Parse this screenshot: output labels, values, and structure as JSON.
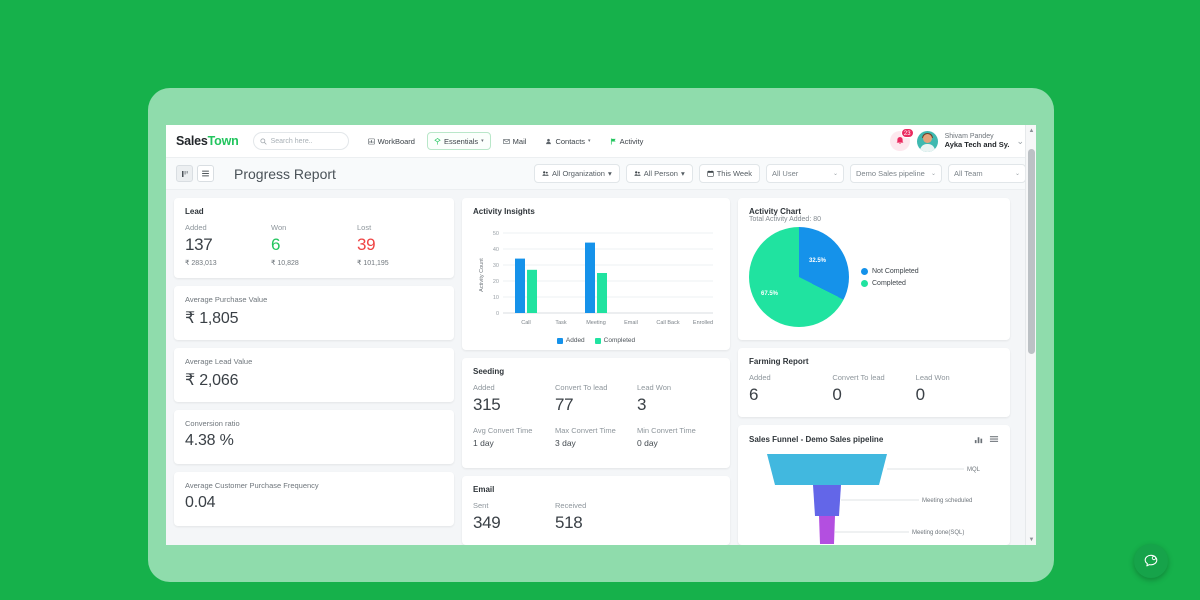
{
  "navbar": {
    "brand_primary": "Sales",
    "brand_accent": "Town",
    "search_placeholder": "Search here..",
    "items": [
      {
        "label": "WorkBoard",
        "icon": "workboard-icon",
        "caret": "",
        "active": false
      },
      {
        "label": "Essentials",
        "icon": "essentials-icon",
        "caret": "▾",
        "active": true
      },
      {
        "label": "Mail",
        "icon": "mail-icon",
        "caret": "",
        "active": false
      },
      {
        "label": "Contacts",
        "icon": "contacts-icon",
        "caret": "▾",
        "active": false
      },
      {
        "label": "Activity",
        "icon": "activity-flag-icon",
        "caret": "",
        "active": false
      }
    ],
    "notification_count": "23",
    "user_name": "Shivam Pandey",
    "user_company": "Ayka Tech and Sy."
  },
  "filterbar": {
    "page_title": "Progress Report",
    "chips": [
      {
        "label": "All Organization",
        "icon": "people-icon",
        "caret": "▾"
      },
      {
        "label": "All Person",
        "icon": "people-icon",
        "caret": "▾"
      },
      {
        "label": "This Week",
        "icon": "calendar-icon",
        "caret": ""
      }
    ],
    "selects": [
      {
        "value": "All User",
        "caret": "⌄"
      },
      {
        "value": "Demo Sales pipeline",
        "caret": "⌄"
      },
      {
        "value": "All Team",
        "caret": "⌄"
      }
    ]
  },
  "lead_card": {
    "title": "Lead",
    "metrics": [
      {
        "label": "Added",
        "value": "137",
        "sub": "₹ 283,013",
        "color": "dark"
      },
      {
        "label": "Won",
        "value": "6",
        "sub": "₹ 10,828",
        "color": "green"
      },
      {
        "label": "Lost",
        "value": "39",
        "sub": "₹ 101,195",
        "color": "red"
      }
    ]
  },
  "simple_cards": [
    {
      "label": "Average Purchase Value",
      "value": "₹ 1,805"
    },
    {
      "label": "Average Lead Value",
      "value": "₹ 2,066"
    },
    {
      "label": "Conversion ratio",
      "value": "4.38 %"
    },
    {
      "label": "Average Customer Purchase Frequency",
      "value": "0.04"
    }
  ],
  "seeding_card": {
    "title": "Seeding",
    "top": [
      {
        "label": "Added",
        "value": "315"
      },
      {
        "label": "Convert To lead",
        "value": "77"
      },
      {
        "label": "Lead Won",
        "value": "3"
      }
    ],
    "bottom": [
      {
        "label": "Avg Convert Time",
        "value": "1 day"
      },
      {
        "label": "Max Convert Time",
        "value": "3 day"
      },
      {
        "label": "Min Convert Time",
        "value": "0 day"
      }
    ]
  },
  "email_card": {
    "title": "Email",
    "metrics": [
      {
        "label": "Sent",
        "value": "349"
      },
      {
        "label": "Received",
        "value": "518"
      }
    ]
  },
  "farming_card": {
    "title": "Farming Report",
    "metrics": [
      {
        "label": "Added",
        "value": "6"
      },
      {
        "label": "Convert To lead",
        "value": "0"
      },
      {
        "label": "Lead Won",
        "value": "0"
      }
    ]
  },
  "activity_chart_card": {
    "title": "Activity Chart",
    "subtitle": "Total Activity Added: 80"
  },
  "funnel_card": {
    "title": "Sales Funnel - Demo Sales pipeline",
    "chart_icon": "bar-chart-icon",
    "menu_icon": "hamburger-menu-icon"
  },
  "chat": {
    "icon": "chat-bubble-icon"
  },
  "colors": {
    "brand_green": "#22c55e",
    "page_bg": "#16b14b",
    "device_bg": "#8fdcac",
    "series_added": "#1592ea",
    "series_completed": "#20e3a0",
    "pie_not_completed": "#1592ea",
    "pie_completed": "#20e3a0",
    "danger": "#ef4444",
    "funnel_mql": "#41b8df",
    "funnel_meeting_scheduled": "#6366e8",
    "funnel_meeting_done": "#b34fe0"
  },
  "chart_data": [
    {
      "type": "bar",
      "title": "Activity Insights",
      "xlabel": "",
      "ylabel": "Activity Count",
      "categories": [
        "Call",
        "Task",
        "Meeting",
        "Email",
        "Call Back",
        "Enrolled"
      ],
      "ylim": [
        0,
        50
      ],
      "yticks": [
        0,
        10,
        20,
        30,
        40,
        50
      ],
      "grid": true,
      "legend": "bottom-center",
      "series": [
        {
          "name": "Added",
          "color": "#1592ea",
          "values": [
            34,
            0,
            44,
            0,
            0,
            0
          ]
        },
        {
          "name": "Completed",
          "color": "#20e3a0",
          "values": [
            27,
            0,
            25,
            0,
            0,
            0
          ]
        }
      ]
    },
    {
      "type": "pie",
      "title": "Activity Chart",
      "subtitle": "Total Activity Added: 80",
      "legend": "right",
      "labels": [
        "Not Completed",
        "Completed"
      ],
      "values": [
        32.5,
        67.5
      ],
      "value_labels": [
        "32.5%",
        "67.5%"
      ],
      "colors": [
        "#1592ea",
        "#20e3a0"
      ]
    },
    {
      "type": "bar",
      "title": "Sales Funnel - Demo Sales pipeline",
      "orientation": "funnel",
      "categories": [
        "MQL",
        "Meeting scheduled",
        "Meeting done(SQL)"
      ],
      "values": [
        100,
        28,
        14
      ],
      "colors": [
        "#41b8df",
        "#6366e8",
        "#b34fe0"
      ]
    }
  ]
}
